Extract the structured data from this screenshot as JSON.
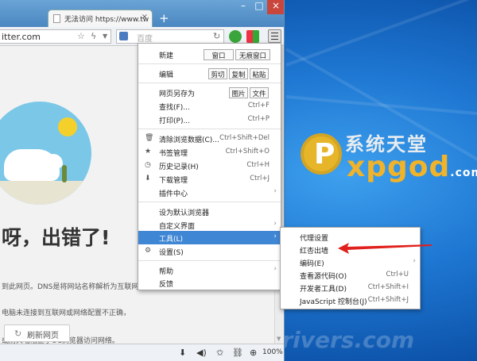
{
  "browser": {
    "tab_title": "无法访问 https://www.tw",
    "tab_close": "×",
    "new_tab": "+",
    "address_url": "itter.com",
    "search_placeholder": "百度",
    "scroll_up": "▲",
    "scroll_down": "▼"
  },
  "page": {
    "error_title": "呀，出错了!",
    "line1": "到此网页。DNS是将网站名称解析为互联网",
    "line2": "电脑未连接到互联网或网络配置不正确，",
    "line3": "或防火墙阻止了UC浏览器访问网络。",
    "refresh_label": "刷新网页"
  },
  "menu": {
    "new_label": "新建",
    "new_window": "窗口",
    "new_incognito": "无痕窗口",
    "edit_label": "编辑",
    "cut": "剪切",
    "copy": "复制",
    "paste": "粘贴",
    "save_as": "网页另存为",
    "save_image": "图片",
    "save_file": "文件",
    "find": "查找(F)...",
    "find_sc": "Ctrl+F",
    "print": "打印(P)...",
    "print_sc": "Ctrl+P",
    "clear": "清除浏览数据(C)...",
    "clear_sc": "Ctrl+Shift+Del",
    "bookmarks": "书签管理",
    "bookmarks_sc": "Ctrl+Shift+O",
    "history": "历史记录(H)",
    "history_sc": "Ctrl+H",
    "downloads": "下载管理",
    "downloads_sc": "Ctrl+J",
    "plugins": "插件中心",
    "set_default": "设为默认浏览器",
    "customize": "自定义界面",
    "tools": "工具(L)",
    "settings": "设置(S)",
    "help": "帮助",
    "feedback": "反馈"
  },
  "submenu": {
    "proxy": "代理设置",
    "red": "红杏出墙",
    "encoding": "编码(E)",
    "view_source": "查看源代码(O)",
    "view_source_sc": "Ctrl+U",
    "devtools": "开发者工具(D)",
    "devtools_sc": "Ctrl+Shift+I",
    "js_console": "JavaScript 控制台(J)",
    "js_console_sc": "Ctrl+Shift+J"
  },
  "status": {
    "zoom": "100%"
  },
  "desktop": {
    "logo_top": "系统天堂",
    "logo_bottom": "xpgod",
    "logo_domain": ".com",
    "logo_letter": "P",
    "watermark": "MyDrivers.com"
  },
  "colors": {
    "highlight": "#3f86d4",
    "arrow": "#e0201c",
    "logo_gold": "#f0b32a"
  },
  "icons": [
    "close-icon",
    "new-tab-icon",
    "back-icon",
    "forward-icon",
    "reload-icon",
    "lightning-icon",
    "dropdown-icon",
    "search-engine-icon",
    "green-shield-icon",
    "grid-apps-icon",
    "menu-icon",
    "download-icon",
    "volume-icon",
    "star-icon",
    "link-icon",
    "zoom-icon",
    "gear-icon",
    "trash-icon",
    "clock-icon",
    "star-bookmark-icon",
    "download-arrow-icon",
    "red-arrow"
  ]
}
